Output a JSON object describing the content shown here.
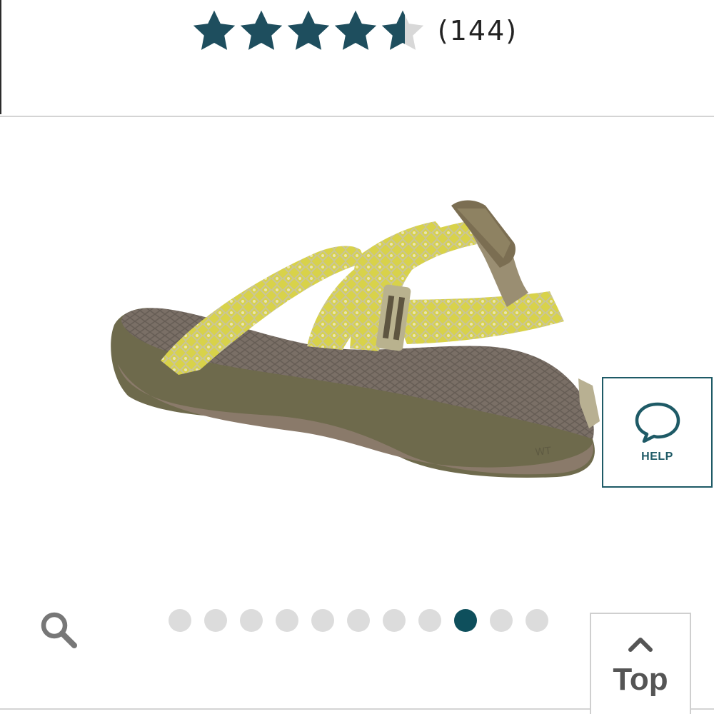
{
  "rating": {
    "value": 4.5,
    "max": 5,
    "review_count": "(144)",
    "star_color": "#1e4e5e",
    "star_empty_color": "#d8d8d8"
  },
  "product_image": {
    "icon": "sandal-image"
  },
  "help": {
    "label": "HELP",
    "icon": "speech-bubble-icon",
    "color": "#1e5a66"
  },
  "gallery": {
    "dot_count": 11,
    "active_index": 8,
    "active_color": "#0e4f5c",
    "inactive_color": "#dcdcdc"
  },
  "zoom": {
    "icon": "search-icon"
  },
  "back_to_top": {
    "label": "Top",
    "icon": "chevron-up-icon"
  }
}
